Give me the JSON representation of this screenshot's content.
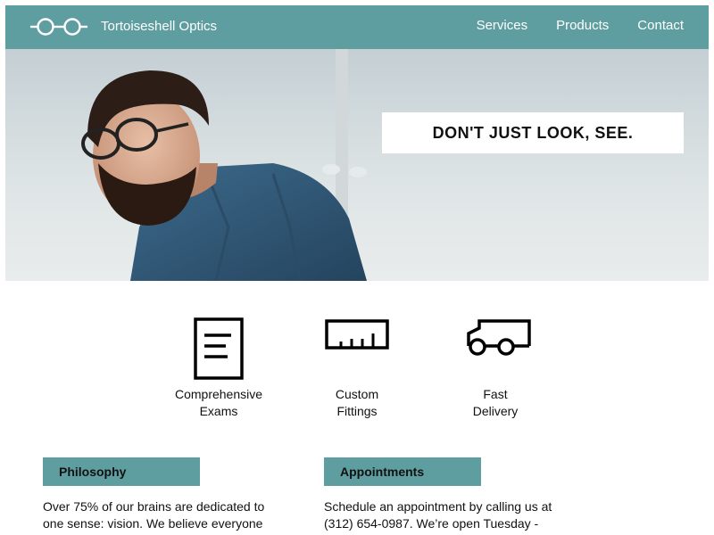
{
  "brand": {
    "name": "Tortoiseshell Optics",
    "logo_icon": "glasses-icon",
    "accent_color": "#5f9ea0"
  },
  "nav": {
    "items": [
      "Services",
      "Products",
      "Contact"
    ]
  },
  "hero": {
    "tagline": "DON'T JUST LOOK, SEE."
  },
  "features": [
    {
      "icon": "document-icon",
      "line1": "Comprehensive",
      "line2": "Exams"
    },
    {
      "icon": "ruler-icon",
      "line1": "Custom",
      "line2": "Fittings"
    },
    {
      "icon": "truck-icon",
      "line1": "Fast",
      "line2": "Delivery"
    }
  ],
  "sections": {
    "philosophy": {
      "heading": "Philosophy",
      "line1": "Over 75% of our brains are dedicated to",
      "line2": "one sense: vision. We believe everyone"
    },
    "appointments": {
      "heading": "Appointments",
      "line1": "Schedule an appointment by calling us at",
      "line2": "(312) 654-0987. We’re open Tuesday -"
    }
  }
}
